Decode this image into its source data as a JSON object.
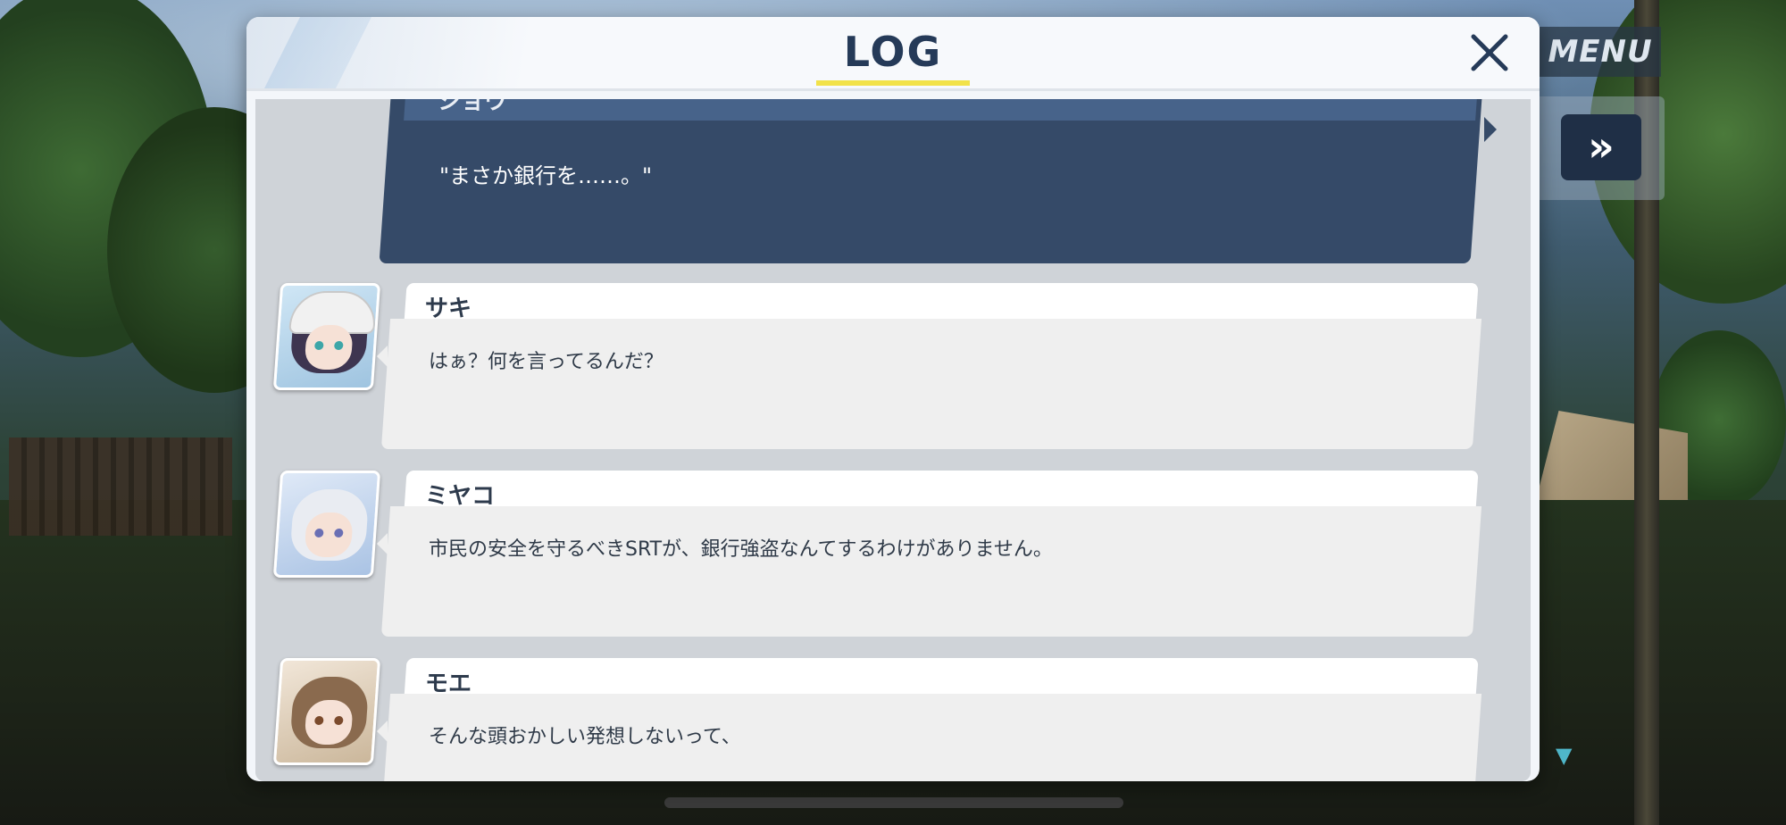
{
  "hud": {
    "menu_label": "MENU",
    "skip_label": "»"
  },
  "log": {
    "title": "LOG",
    "close_label": "✕",
    "entries": [
      {
        "speaker": "ショウ",
        "text": "\"まさか銀行を……。\"",
        "is_player": true
      },
      {
        "speaker": "サキ",
        "text": "はぁ？何を言ってるんだ？",
        "is_player": false
      },
      {
        "speaker": "ミヤコ",
        "text": "市民の安全を守るべきSRTが、銀行強盗なんてするわけがありません。",
        "is_player": false
      },
      {
        "speaker": "モエ",
        "text": "そんな頭おかしい発想しないって、",
        "is_player": false
      }
    ]
  },
  "colors": {
    "accent_yellow": "#f2e24a",
    "title_navy": "#253a58",
    "player_card": "#354a68",
    "npc_card": "#efefef"
  },
  "icons": {
    "close": "close-icon",
    "skip": "fast-forward-icon",
    "scroll_down": "triangle-down-icon"
  }
}
